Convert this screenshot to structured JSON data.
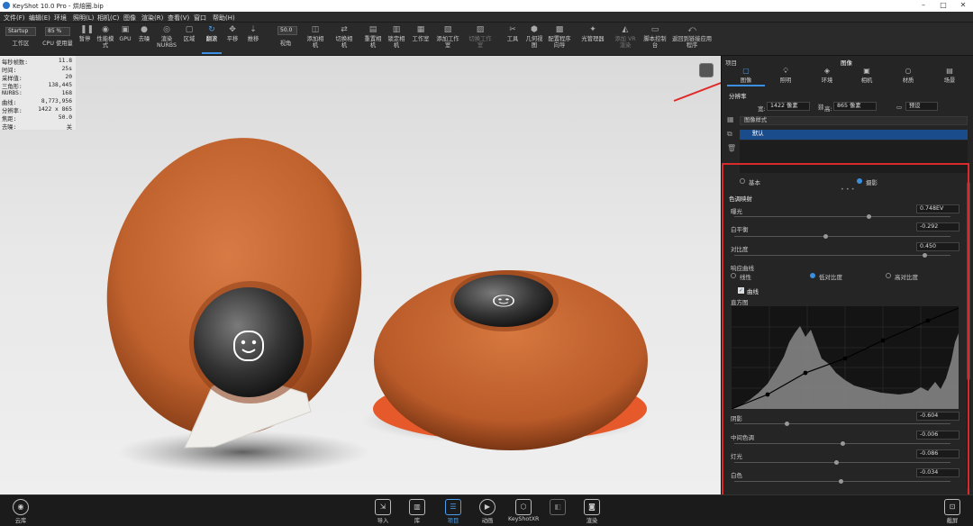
{
  "window": {
    "app_title": "KeyShot 10.0 Pro - 烘焙圈.bip"
  },
  "menu": [
    "文件(F)",
    "编辑(E)",
    "环境",
    "照明(L)",
    "相机(C)",
    "图像",
    "渲染(R)",
    "查看(V)",
    "窗口",
    "帮助(H)"
  ],
  "toolbar": {
    "workspace_select": "Startup",
    "zoom_select": "85 %",
    "cpu_usage_label": "CPU 使用量",
    "focal_value": "50.0",
    "buttons": [
      "工作区",
      "CPU 使用量",
      "暂停",
      "性能模式",
      "GPU",
      "去噪",
      "渲染 NURBS",
      "区域",
      "翻滚",
      "平移",
      "推移",
      "视角",
      "添加相机",
      "切换相机",
      "重置相机",
      "锁定相机",
      "工作室",
      "添加工作室",
      "切换工作室",
      "工具",
      "几何视图",
      "配置程序向导",
      "光管理器",
      "添加 VR 渲染",
      "脚本控制台",
      "返回到链接应用程序"
    ]
  },
  "stats": [
    {
      "k": "每秒帧数:",
      "v": "11.8"
    },
    {
      "k": "时间:",
      "v": "25s"
    },
    {
      "k": "采样值:",
      "v": "20"
    },
    {
      "k": "三角形:",
      "v": "138,445"
    },
    {
      "k": "NURBS:",
      "v": "168"
    },
    {
      "k": "曲线:",
      "v": "8,773,956"
    },
    {
      "k": "分辨率:",
      "v": "1422 x 865"
    },
    {
      "k": "焦距:",
      "v": "50.0"
    },
    {
      "k": "去噪:",
      "v": "关"
    }
  ],
  "face_icons": [
    "smiley-face-icon",
    "smiley-face-icon"
  ],
  "panel": {
    "project_label": "项目",
    "title": "图像",
    "tabs": [
      "图像",
      "照明",
      "环境",
      "相机",
      "材质",
      "场景"
    ],
    "resolution_label": "分辨率",
    "width_label": "宽:",
    "width_value": "1422 像素",
    "height_label": "高:",
    "height_value": "865 像素",
    "preset_label": "预设",
    "style_header": "图像样式",
    "style_item": "默认",
    "mode_basic": "基本",
    "mode_photo": "摄影",
    "tone_mapping": "色调映射",
    "exposure_label": "曝光",
    "exposure_value": "0.748EV",
    "exposure_level": 0.62,
    "white_balance_label": "白平衡",
    "white_balance_value": "-0.292",
    "white_balance_level": 0.42,
    "contrast_label": "对比度",
    "contrast_value": "0.450",
    "contrast_level": 0.88,
    "response_label": "响应曲线",
    "response_opts": [
      "线性",
      "低对比度",
      "高对比度"
    ],
    "curve_label": "曲线",
    "histogram_label": "直方图",
    "shadows_label": "阴影",
    "shadows_value": "-0.604",
    "shadows_level": 0.24,
    "midtones_label": "中间色调",
    "midtones_value": "-0.006",
    "midtones_level": 0.5,
    "highlights_label": "灯光",
    "highlights_value": "-0.086",
    "highlights_level": 0.47,
    "whites_label": "白色",
    "whites_value": "-0.034",
    "whites_level": 0.49
  },
  "bottom": {
    "cloud": "云库",
    "items": [
      "导入",
      "库",
      "项目",
      "动画",
      "KeyShotXR",
      "渲染"
    ],
    "share": "截屏"
  },
  "colors": {
    "accent": "#3c8fe0",
    "highlight_box": "#d92b2b",
    "speaker": "#c0622e"
  }
}
